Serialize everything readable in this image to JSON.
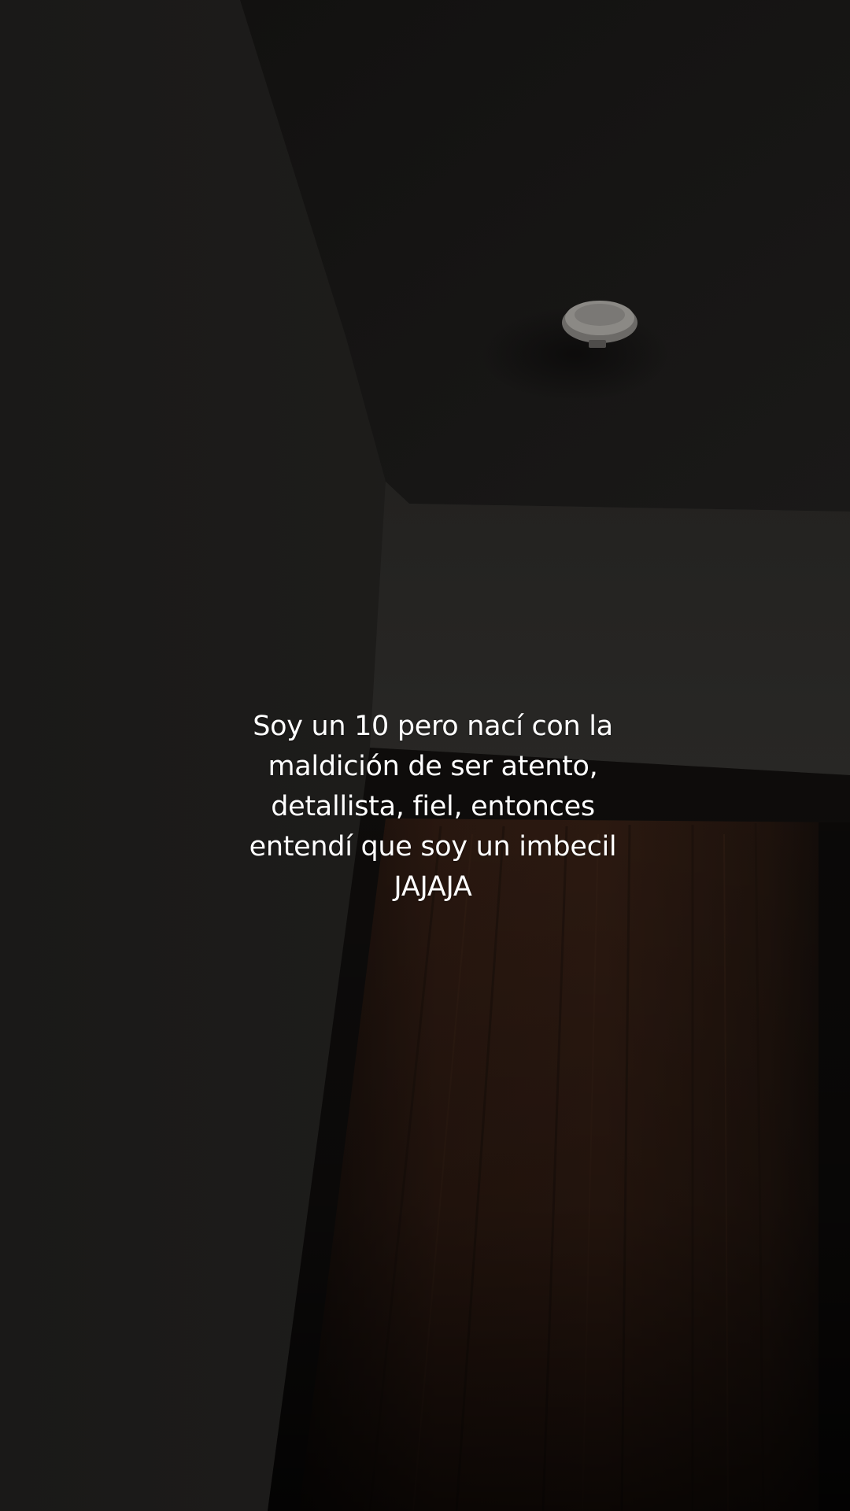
{
  "caption": {
    "lines": [
      "Soy un 10 pero nací con la",
      "maldición de ser atento,",
      "detallista, fiel, entonces",
      "entendí que soy un imbecil",
      "JAJAJA"
    ]
  },
  "scene": {
    "description_icons": [
      "smoke-detector-icon"
    ],
    "colors": {
      "ceiling": "#141312",
      "left_wall": "#1d1c1a",
      "right_wall": "#242320",
      "door": "#2a1a12",
      "door_frame": "#0e0c0b",
      "caption_text": "#ffffff"
    }
  }
}
